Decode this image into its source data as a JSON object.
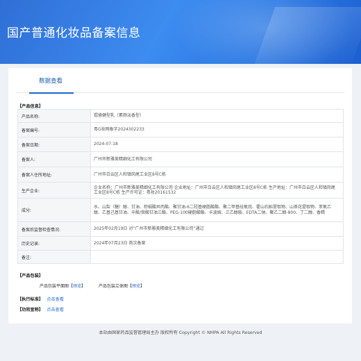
{
  "header": {
    "title": "国产普通化妆品备案信息"
  },
  "tabs": [
    {
      "label": "数据查看"
    }
  ],
  "sections": {
    "product_info": "【产品信息】",
    "packaging": "【产品包装】",
    "standard": "【执行标准】",
    "efficacy": "【功效宣称】"
  },
  "rows": [
    {
      "key": "产品名称:",
      "value": "琨德健型乳（素颜淡香型）"
    },
    {
      "key": "备案编号:",
      "value": "粤G妆网备字2024302233"
    },
    {
      "key": "备案日期:",
      "value": "2024-07-18"
    },
    {
      "key": "备案人:",
      "value": "广州市新雅美精细化工有限公司"
    },
    {
      "key": "备案人住所地址:",
      "value": "广州市白云区人和镇岗尾工业区8号C栋"
    },
    {
      "key": "生产企业:",
      "value": "企业名称：广州市新雅美精细化工有限公司 企业地址：广州市白云区人和镇岗尾工业区8号C栋 生产地址：广州市白云区人和镇岗尾工业区8号C栋 生产许可证：粤妆20161532"
    },
    {
      "key": "成分:",
      "value": "水、山梨（糖）醇、甘油、棕榈酸异丙酯、聚甘油-6二羟基硬脂酸酯、聚二甲基硅氧烷、霍山石斛提取物、山茶花提取物、苯氧乙醇、乙基己基甘油、辛酸/癸酸甘油三酯、PEG-100硬脂酸酯、卡波姆、三乙醇胺、EDTA二钠、聚乙二醇-800、丁二醇、香精"
    },
    {
      "key": "备案后监督检查情况:",
      "value": "2025年02月19日 对“广州市新雅美精细化工有限公司”通过"
    },
    {
      "key": "历史记录:",
      "value": "2024年07月23日 首次备案"
    },
    {
      "key": "备注:",
      "value": ""
    }
  ],
  "packaging": {
    "flat_label": "产品包装平面图",
    "flat_link": "预览",
    "solid_label": "产品包装立体图",
    "solid_link": "预览"
  },
  "standard_link": "点击查看",
  "efficacy_link": "点击查看",
  "footer": "本站由国家药品监督管理局主办 版权所有 Copyright © NMPA All Rights Reserved"
}
